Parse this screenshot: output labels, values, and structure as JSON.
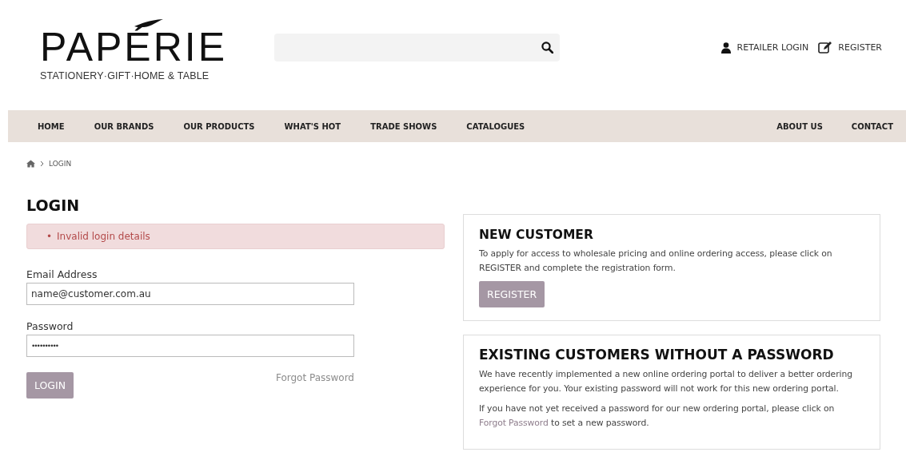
{
  "header": {
    "logo": {
      "name": "PAPÉRIE",
      "tagline": "STATIONERY·GIFT·HOME & TABLE"
    },
    "links": [
      {
        "kind": "user",
        "label": "RETAILER LOGIN"
      },
      {
        "kind": "edit",
        "label": "REGISTER"
      }
    ]
  },
  "nav": {
    "left_items": [
      "HOME",
      "OUR BRANDS",
      "OUR PRODUCTS",
      "WHAT'S HOT",
      "TRADE SHOWS",
      "CATALOGUES"
    ],
    "right_items": [
      "ABOUT US",
      "CONTACT"
    ]
  },
  "breadcrumb": {
    "items": [
      "LOGIN"
    ]
  },
  "login": {
    "title": "LOGIN",
    "errors": [
      {
        "bullet": "•",
        "text": "Invalid login details"
      }
    ],
    "fields": [
      {
        "label": "Email Address",
        "value": "name@customer.com.au",
        "kind": "text"
      },
      {
        "label": "Password",
        "value": "••••••••••",
        "kind": "password"
      }
    ],
    "button": "LOGIN",
    "forgot_link": "Forgot Password"
  },
  "new_customer": {
    "title": "NEW CUSTOMER",
    "text": "To apply for access to wholesale pricing and online ordering access, please click on REGISTER and complete the registration form.",
    "button": "REGISTER"
  },
  "existing_customers": {
    "title": "EXISTING CUSTOMERS WITHOUT A PASSWORD",
    "paragraphs": [
      {
        "text_before": "We have recently implemented a new online ordering portal to deliver a better ordering experience for you. Your existing password will not work for this new ordering portal."
      },
      {
        "text_before": "If you have not yet received a password for our new ordering portal, please click on ",
        "link": "Forgot Password",
        "text_after": " to set a new password."
      }
    ]
  }
}
